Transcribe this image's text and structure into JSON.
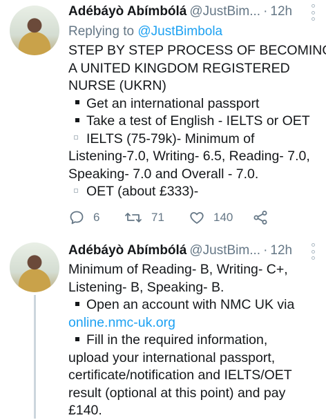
{
  "tweets": [
    {
      "name": "Adébáyò Abímbólá",
      "handle": "@JustBim...",
      "separator": "·",
      "time": "12h",
      "replying_prefix": "Replying to",
      "replying_handle": "@JustBimbola",
      "lines": [
        "STEP BY STEP PROCESS OF BECOMING",
        "A UNITED KINGDOM REGISTERED",
        "NURSE (UKRN)",
        "Get an international passport",
        "Take a test of English - IELTS or OET",
        "IELTS (75-79k)- Minimum of",
        "Listening-7.0, Writing- 6.5, Reading- 7.0,",
        "Speaking- 7.0 and Overall - 7.0.",
        "OET (about £333)-"
      ],
      "actions": {
        "reply_icon": "comment-icon",
        "reply_count": "6",
        "retweet_icon": "retweet-icon",
        "retweet_count": "71",
        "like_icon": "heart-icon",
        "like_count": "140",
        "share_icon": "share-icon"
      }
    },
    {
      "name": "Adébáyò Abímbólá",
      "handle": "@JustBim...",
      "separator": "·",
      "time": "12h",
      "lines": [
        "Minimum of Reading- B, Writing- C+,",
        "Listening- B, Speaking- B.",
        "Open an account with NMC UK via",
        "online.nmc-uk.org",
        "Fill in the required information,",
        "upload your international passport,",
        "certificate/notification and IELTS/OET",
        "result (optional at this point) and pay",
        "£140."
      ]
    }
  ],
  "colors": {
    "link": "#1da1f2",
    "secondary": "#657786",
    "thread_line": "#ccd6dd"
  }
}
